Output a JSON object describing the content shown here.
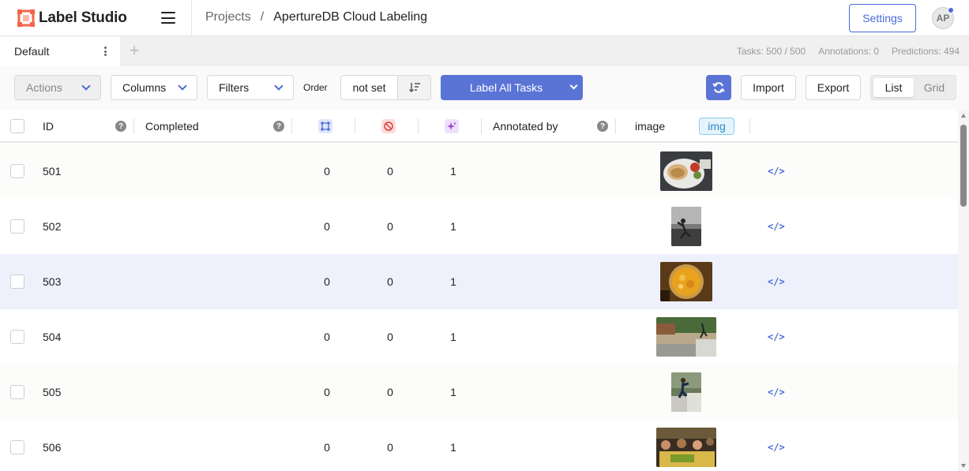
{
  "header": {
    "logo_text": "Label Studio",
    "breadcrumb_projects": "Projects",
    "breadcrumb_separator": "/",
    "breadcrumb_current": "ApertureDB Cloud Labeling",
    "settings_label": "Settings",
    "avatar_initials": "AP"
  },
  "tabs": {
    "active_tab": "Default",
    "add_tab_icon": "+",
    "stats": {
      "tasks": "Tasks: 500 / 500",
      "annotations": "Annotations: 0",
      "predictions": "Predictions: 494"
    }
  },
  "toolbar": {
    "actions_label": "Actions",
    "columns_label": "Columns",
    "filters_label": "Filters",
    "order_label": "Order",
    "order_value": "not set",
    "label_all_label": "Label All Tasks",
    "import_label": "Import",
    "export_label": "Export",
    "view_list": "List",
    "view_grid": "Grid",
    "accent_color": "#5a74d6"
  },
  "table": {
    "columns": {
      "id": "ID",
      "completed": "Completed",
      "annotated_by": "Annotated by",
      "image": "image",
      "image_type_tag": "img"
    },
    "rows": [
      {
        "id": "501",
        "annotations": "0",
        "cancelled": "0",
        "predictions": "1",
        "thumb": "food-plate"
      },
      {
        "id": "502",
        "annotations": "0",
        "cancelled": "0",
        "predictions": "1",
        "thumb": "bw-person"
      },
      {
        "id": "503",
        "annotations": "0",
        "cancelled": "0",
        "predictions": "1",
        "thumb": "soup-bowl"
      },
      {
        "id": "504",
        "annotations": "0",
        "cancelled": "0",
        "predictions": "1",
        "thumb": "skatepark"
      },
      {
        "id": "505",
        "annotations": "0",
        "cancelled": "0",
        "predictions": "1",
        "thumb": "skateboarder"
      },
      {
        "id": "506",
        "annotations": "0",
        "cancelled": "0",
        "predictions": "1",
        "thumb": "market-group"
      }
    ],
    "highlighted_row": "503"
  }
}
